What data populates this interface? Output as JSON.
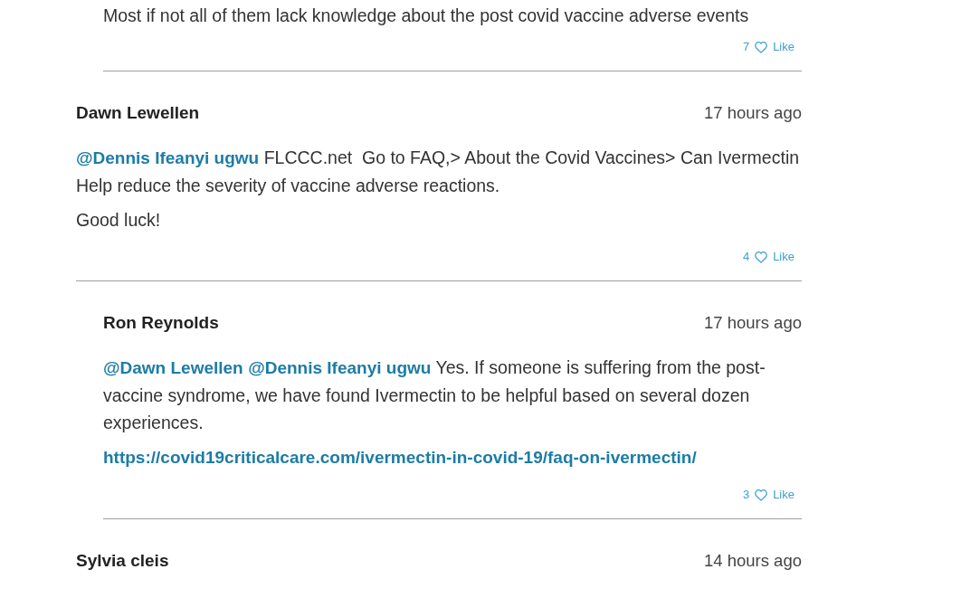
{
  "comments": [
    {
      "replies": [
        {
          "paragraphs": [
            [
              {
                "kind": "text",
                "text": "Most if not all of them lack knowledge about the post covid vaccine adverse events"
              }
            ]
          ],
          "likes": "7",
          "like_label": "Like"
        }
      ]
    },
    {
      "author": "Dawn Lewellen",
      "time": "17 hours ago",
      "paragraphs": [
        [
          {
            "kind": "mention",
            "text": "@Dennis Ifeanyi ugwu"
          },
          {
            "kind": "text",
            "text": " FLCCC.net  Go to FAQ,> About the Covid Vaccines> Can Ivermectin Help reduce the severity of vaccine adverse reactions."
          }
        ],
        [
          {
            "kind": "text",
            "text": "Good luck!"
          }
        ]
      ],
      "likes": "4",
      "like_label": "Like",
      "replies": [
        {
          "author": "Ron Reynolds",
          "time": "17 hours ago",
          "paragraphs": [
            [
              {
                "kind": "mention",
                "text": "@Dawn Lewellen"
              },
              {
                "kind": "mention",
                "text": "@Dennis Ifeanyi ugwu"
              },
              {
                "kind": "text",
                "text": " Yes. If someone is suffering from the post-vaccine syndrome, we have found Ivermectin to be helpful based on several dozen experiences."
              }
            ],
            [
              {
                "kind": "link",
                "text": "https://covid19criticalcare.com/ivermectin-in-covid-19/faq-on-ivermectin/"
              }
            ]
          ],
          "likes": "3",
          "like_label": "Like"
        }
      ]
    },
    {
      "author": "Sylvia cleis",
      "time": "14 hours ago"
    }
  ]
}
